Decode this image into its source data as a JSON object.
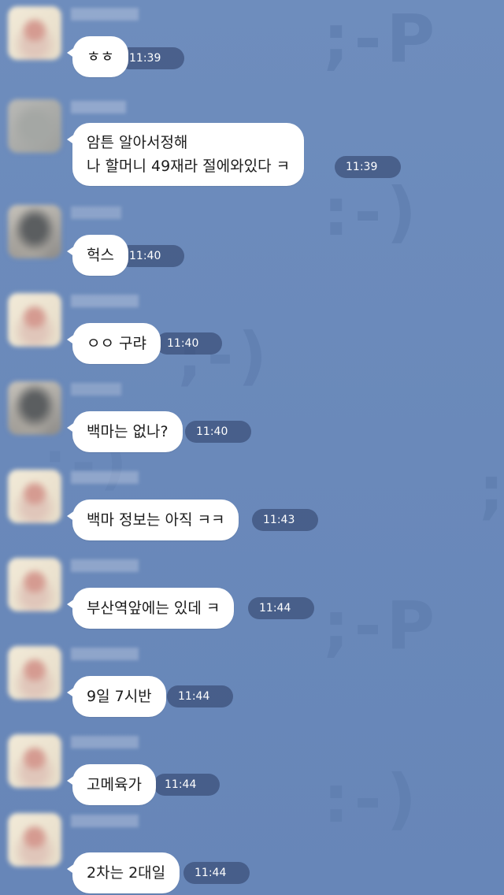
{
  "background": {
    "color": "#6a89ba",
    "emoticons": [
      ";-P",
      ":-)",
      ";-)",
      ";",
      ":-)",
      ";-P",
      ":-)"
    ]
  },
  "messages": [
    {
      "avatar": "avatar-light",
      "name": "",
      "lines": [
        "ㅎㅎ"
      ],
      "time": "11:39"
    },
    {
      "avatar": "avatar-gray",
      "name": "",
      "lines": [
        "암튼 알아서정해",
        "나 할머니 49재라 절에와있다 ㅋ"
      ],
      "time": "11:39"
    },
    {
      "avatar": "avatar-dark",
      "name": "",
      "lines": [
        "헉스"
      ],
      "time": "11:40"
    },
    {
      "avatar": "avatar-light",
      "name": "",
      "lines": [
        "ㅇㅇ 구랴"
      ],
      "time": "11:40"
    },
    {
      "avatar": "avatar-dark",
      "name": "",
      "lines": [
        "백마는 없나?"
      ],
      "time": "11:40"
    },
    {
      "avatar": "avatar-light",
      "name": "",
      "lines": [
        "백마 정보는 아직 ㅋㅋ"
      ],
      "time": "11:43"
    },
    {
      "avatar": "avatar-light",
      "name": "",
      "lines": [
        "부산역앞에는 있데 ㅋ"
      ],
      "time": "11:44"
    },
    {
      "avatar": "avatar-light",
      "name": "",
      "lines": [
        "9일 7시반"
      ],
      "time": "11:44"
    },
    {
      "avatar": "avatar-light",
      "name": "",
      "lines": [
        "고메육가"
      ],
      "time": "11:44"
    },
    {
      "avatar": "avatar-light",
      "name": "",
      "lines": [
        "2차는 2대일"
      ],
      "time": "11:44"
    }
  ]
}
